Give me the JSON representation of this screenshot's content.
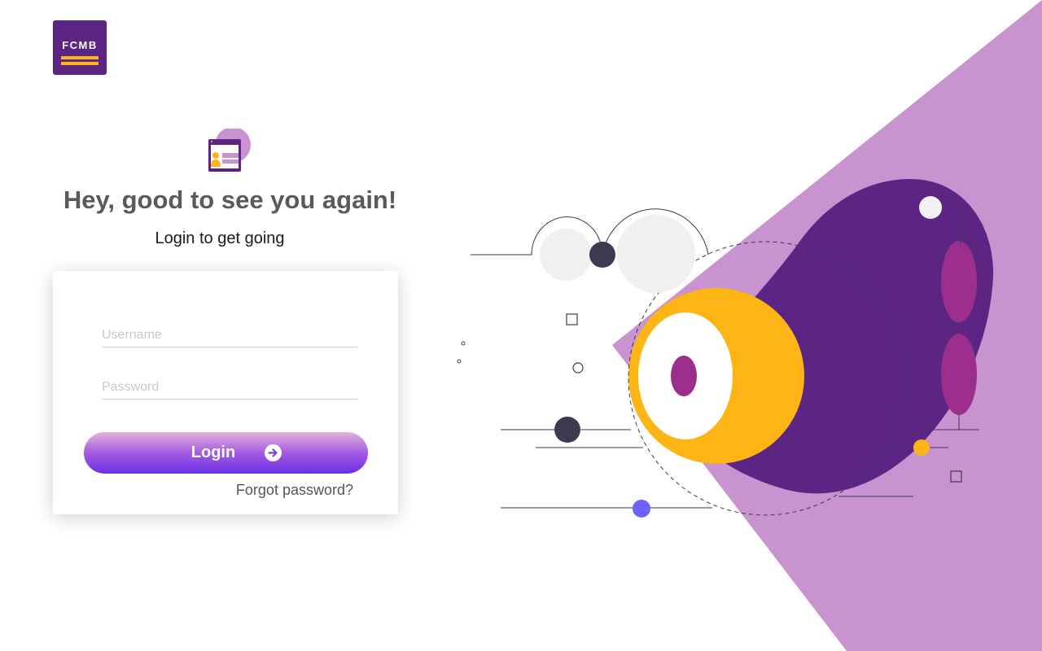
{
  "brand": {
    "logo_text": "FCMB",
    "colors": {
      "primary": "#5c2483",
      "accent": "#fdb515",
      "light_purple": "#c993d0",
      "magenta": "#9c2f8e"
    }
  },
  "header": {
    "icon": "login-window-icon",
    "title": "Hey, good to see you again!",
    "subtitle": "Login to get going"
  },
  "form": {
    "username_placeholder": "Username",
    "username_value": "",
    "password_placeholder": "Password",
    "password_value": "",
    "login_label": "Login",
    "login_icon": "arrow-right-circle-icon",
    "forgot_label": "Forgot password?"
  },
  "illustration": {
    "icon": "abstract-eye-illustration"
  }
}
